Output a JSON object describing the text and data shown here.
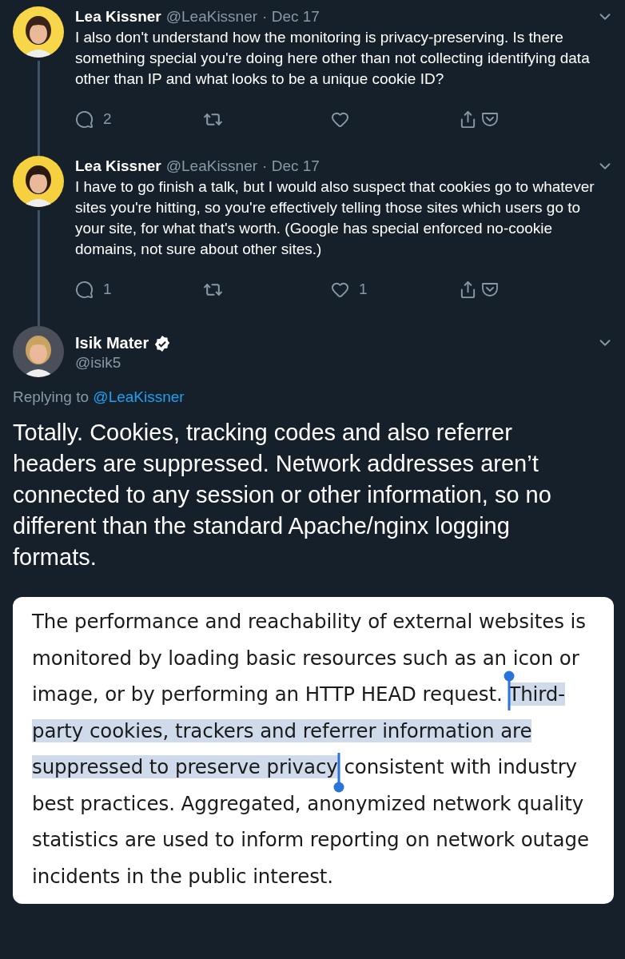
{
  "thread": [
    {
      "name": "Lea Kissner",
      "handle": "@LeaKissner",
      "date": "· Dec 17",
      "text": "I also don't understand how the monitoring is privacy-preserving. Is there something special you're doing here other than not collecting identifying data other than IP and what looks to be a unique cookie ID?",
      "replies": "2"
    },
    {
      "name": "Lea Kissner",
      "handle": "@LeaKissner",
      "date": "· Dec 17",
      "text": "I have to go finish a talk, but I would also suspect that cookies go to whatever sites you're hitting, so you're effectively telling those sites which users go to your site, for what that's worth. (Google has special enforced no-cookie domains, not sure about other sites.)",
      "replies": "1",
      "likes": "1"
    }
  ],
  "focused_tweet": {
    "name": "Isik Mater",
    "verified": true,
    "handle": "@isik5",
    "replying_label": "Replying to",
    "replying_to": "@LeaKissner",
    "text": "Totally. Cookies, tracking codes and also referrer headers are suppressed. Network addresses aren’t connected to any session or other information, so no different than the standard Apache/nginx logging formats.",
    "attached_screenshot": {
      "before": "The performance and reachability of external websites is monitored by loading basic resources such as an icon or image, or by performing an HTTP HEAD request. ",
      "selected": "Third-party cookies, trackers and referrer information are suppressed to preserve privacy",
      "after": " consistent with industry best practices. Aggregated, anonymized network quality statistics are used to inform reporting on network outage incidents in the public interest."
    }
  }
}
